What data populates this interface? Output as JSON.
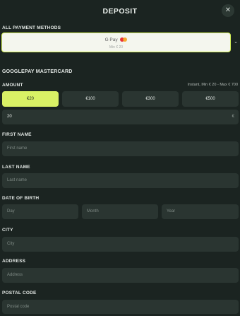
{
  "header": {
    "title": "DEPOSIT",
    "close_icon": "close-icon"
  },
  "payment_methods": {
    "label": "ALL PAYMENT METHODS",
    "selected": {
      "logo_text": "G Pay",
      "min_text": "Min € 20"
    }
  },
  "method_name": "GOOGLEPAY MASTERCARD",
  "amount": {
    "label": "AMOUNT",
    "hint": "Instant, Min € 20 - Max € 700",
    "options": [
      "€20",
      "€100",
      "€300",
      "€500"
    ],
    "selected_index": 0,
    "value": "20",
    "currency": "€"
  },
  "first_name": {
    "label": "FIRST NAME",
    "placeholder": "First name"
  },
  "last_name": {
    "label": "LAST NAME",
    "placeholder": "Last name"
  },
  "dob": {
    "label": "DATE OF BIRTH",
    "day": "Day",
    "month": "Month",
    "year": "Year"
  },
  "city": {
    "label": "CITY",
    "placeholder": "City"
  },
  "address": {
    "label": "ADDRESS",
    "placeholder": "Address"
  },
  "postal_code": {
    "label": "POSTAL CODE",
    "placeholder": "Postal code"
  },
  "colors": {
    "accent": "#d9f165",
    "background": "#1b2421",
    "field": "#2a3531"
  }
}
